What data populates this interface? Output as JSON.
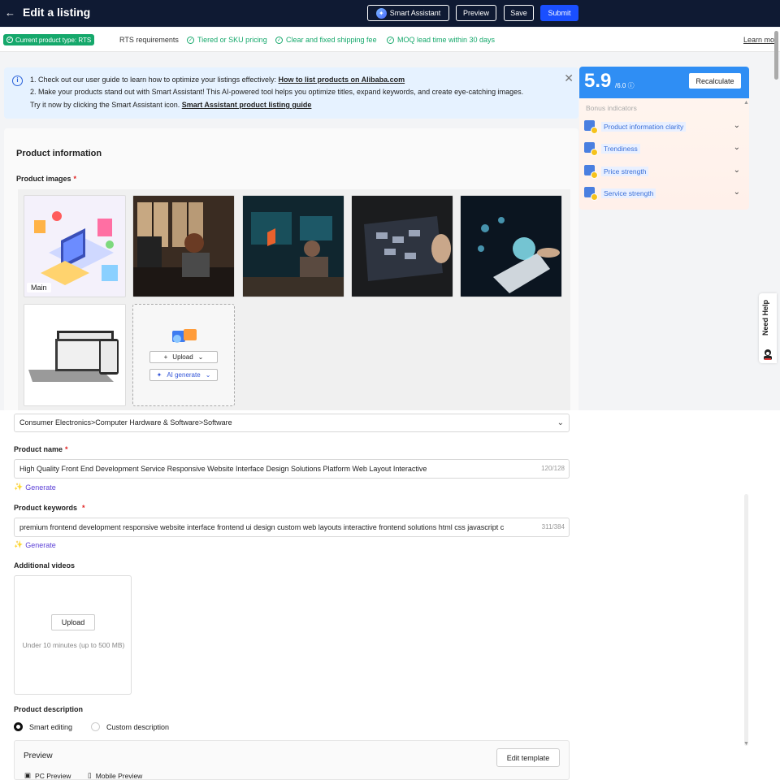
{
  "header": {
    "back_icon": "arrow-left-icon",
    "title": "Edit a listing",
    "smart_assistant": "Smart Assistant",
    "preview": "Preview",
    "save": "Save",
    "submit": "Submit"
  },
  "requirements": {
    "product_type": "Current product type:  RTS",
    "rts_label": "RTS requirements",
    "items": [
      "Tiered or SKU pricing",
      "Clear and fixed shipping fee",
      "MOQ lead time within 30 days"
    ],
    "learn_more": "Learn mor"
  },
  "tip": {
    "line1_text": "1. Check out our user guide to learn how to optimize your listings effectively: ",
    "line1_link": "How to list products on Alibaba.com",
    "line2_text": "2. Make your products stand out with Smart Assistant! This AI-powered tool helps you optimize titles, expand keywords, and create eye-catching images.",
    "line3_text": "Try it now by clicking the Smart Assistant icon. ",
    "line3_link": "Smart Assistant product listing guide"
  },
  "product_info": {
    "section_title": "Product information",
    "images_label": "Product images",
    "main_tag": "Main",
    "upload": "Upload",
    "ai_generate": "AI generate",
    "category": "Consumer Electronics>Computer Hardware & Software>Software",
    "name_label": "Product name",
    "name_value": "High Quality Front End Development Service Responsive Website Interface Design Solutions Platform Web Layout Interactive",
    "name_count": "120/128",
    "generate": "Generate",
    "keywords_label": "Product keywords",
    "keywords_value": "premium frontend development responsive website interface frontend ui design custom web layouts interactive frontend solutions html css javascript c",
    "keywords_count": "311/384",
    "videos_label": "Additional videos",
    "video_upload": "Upload",
    "video_hint": "Under 10 minutes (up to 500 MB)",
    "description_label": "Product description",
    "smart_editing": "Smart editing",
    "custom_description": "Custom description",
    "preview_title": "Preview",
    "edit_template": "Edit template",
    "pc_preview": "PC Preview",
    "mobile_preview": "Mobile Preview"
  },
  "score": {
    "value": "5.9",
    "max": "/6.0",
    "recalculate": "Recalculate",
    "bonus_label": "Bonus indicators",
    "indicators": [
      "Product information clarity",
      "Trendiness",
      "Price strength",
      "Service strength"
    ]
  },
  "help": {
    "label": "Need Help"
  },
  "colors": {
    "topbar": "#0f1a33",
    "submit": "#1a4fff",
    "success": "#15a86b",
    "score_header": "#2f8ef4"
  }
}
